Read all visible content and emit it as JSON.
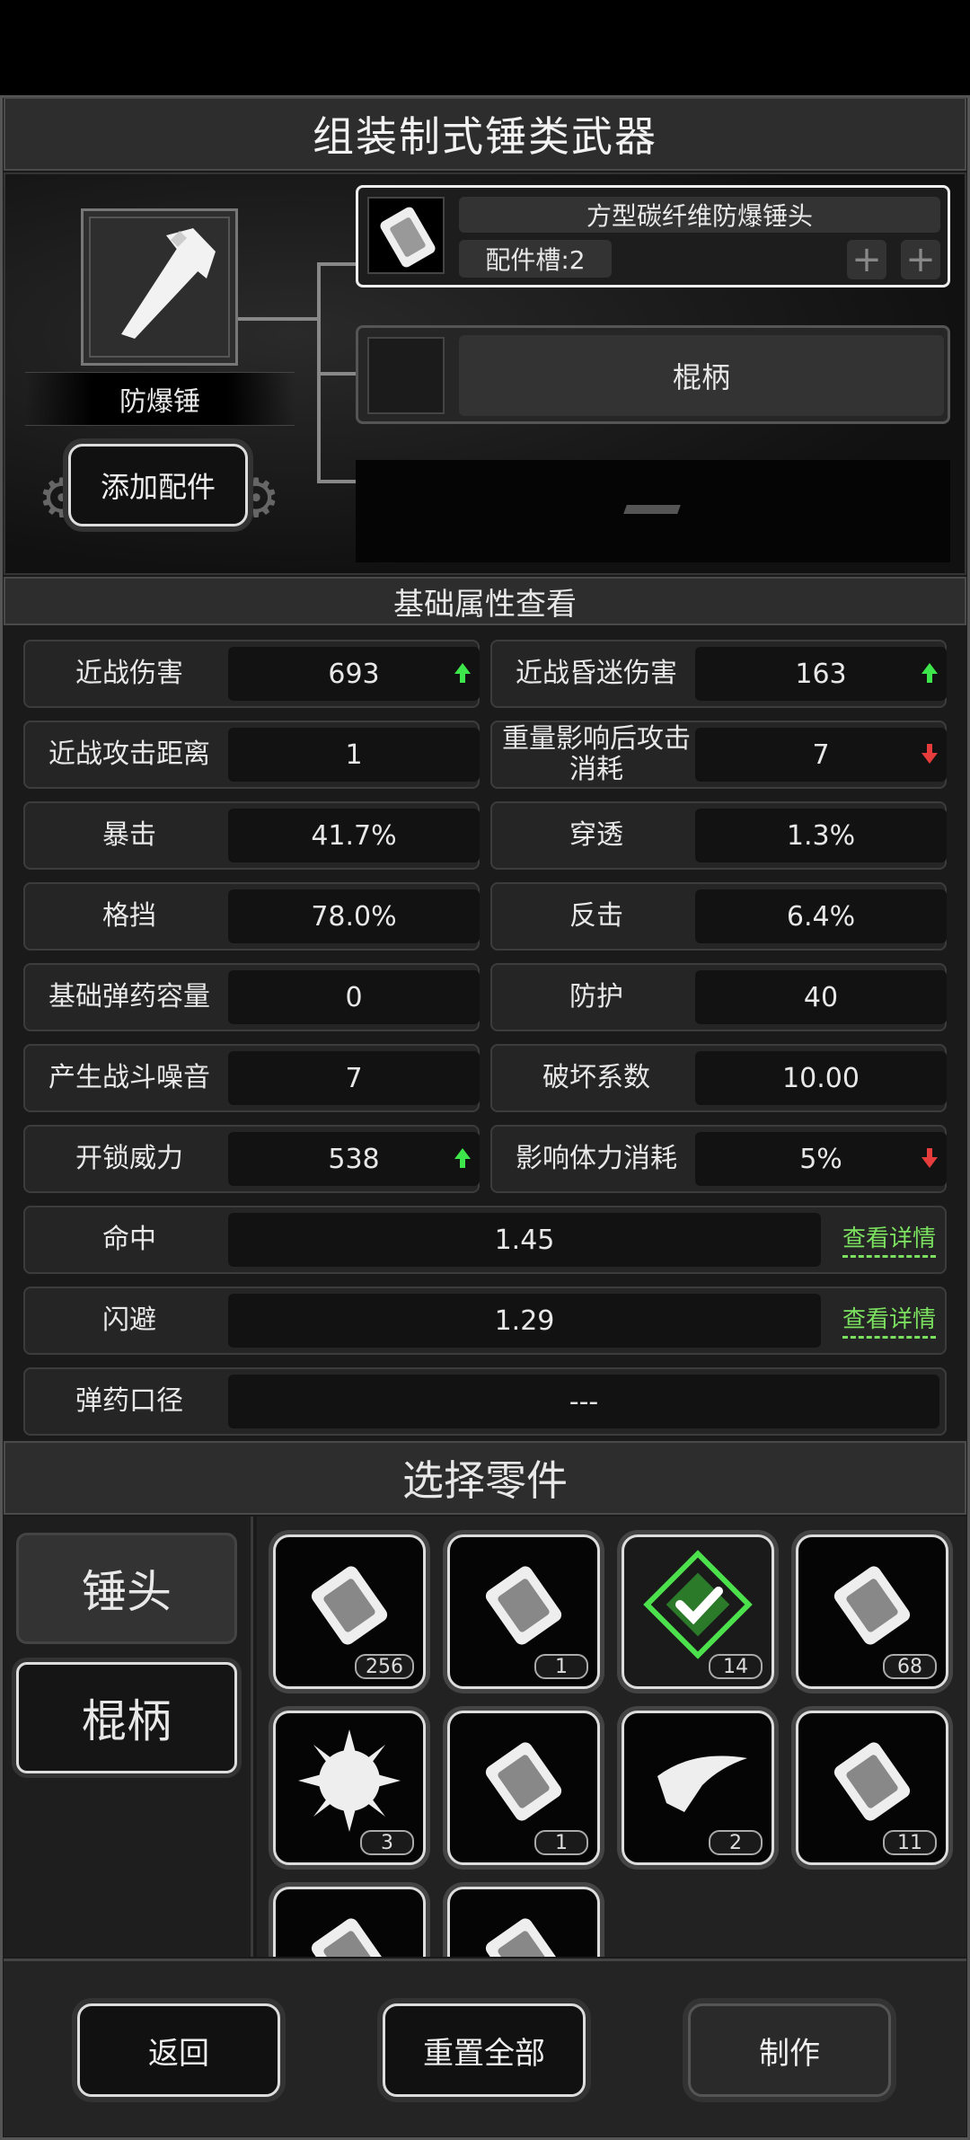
{
  "header": {
    "title": "组装制式锤类武器"
  },
  "assembly": {
    "weapon_name": "防爆锤",
    "add_part_label": "添加配件",
    "head_slot": {
      "name": "方型碳纤维防爆锤头",
      "slots_label": "配件槽:2"
    },
    "handle_slot": {
      "name": "棍柄"
    }
  },
  "attributes": {
    "title": "基础属性查看",
    "detail_label": "查看详情",
    "rows": [
      {
        "left": {
          "label": "近战伤害",
          "value": "693",
          "trend": "up"
        },
        "right": {
          "label": "近战昏迷伤害",
          "value": "163",
          "trend": "up"
        }
      },
      {
        "left": {
          "label": "近战攻击距离",
          "value": "1",
          "trend": ""
        },
        "right": {
          "label": "重量影响后攻击消耗",
          "value": "7",
          "trend": "down"
        }
      },
      {
        "left": {
          "label": "暴击",
          "value": "41.7%",
          "trend": ""
        },
        "right": {
          "label": "穿透",
          "value": "1.3%",
          "trend": ""
        }
      },
      {
        "left": {
          "label": "格挡",
          "value": "78.0%",
          "trend": ""
        },
        "right": {
          "label": "反击",
          "value": "6.4%",
          "trend": ""
        }
      },
      {
        "left": {
          "label": "基础弹药容量",
          "value": "0",
          "trend": ""
        },
        "right": {
          "label": "防护",
          "value": "40",
          "trend": ""
        }
      },
      {
        "left": {
          "label": "产生战斗噪音",
          "value": "7",
          "trend": ""
        },
        "right": {
          "label": "破坏系数",
          "value": "10.00",
          "trend": ""
        }
      },
      {
        "left": {
          "label": "开锁威力",
          "value": "538",
          "trend": "up"
        },
        "right": {
          "label": "影响体力消耗",
          "value": "5%",
          "trend": "down"
        }
      }
    ],
    "hit": {
      "label": "命中",
      "value": "1.45"
    },
    "dodge": {
      "label": "闪避",
      "value": "1.29"
    },
    "caliber": {
      "label": "弹药口径",
      "value": "---"
    }
  },
  "parts": {
    "title": "选择零件",
    "tabs": [
      {
        "label": "锤头"
      },
      {
        "label": "棍柄"
      }
    ],
    "items": [
      {
        "icon": "spiked-hammer-head-icon",
        "count": "256"
      },
      {
        "icon": "hammer-head-icon",
        "count": "1"
      },
      {
        "icon": "selected-check-icon",
        "count": "14"
      },
      {
        "icon": "block-hammer-head-icon",
        "count": "68"
      },
      {
        "icon": "spiked-ball-icon",
        "count": "3"
      },
      {
        "icon": "heavy-hammer-head-icon",
        "count": "1"
      },
      {
        "icon": "pick-head-icon",
        "count": "2"
      },
      {
        "icon": "studded-hammer-head-icon",
        "count": "11"
      },
      {
        "icon": "curved-blade-icon",
        "count": ""
      },
      {
        "icon": "spiked-mace-icon",
        "count": ""
      }
    ]
  },
  "footer": {
    "back_label": "返回",
    "reset_label": "重置全部",
    "craft_label": "制作"
  }
}
